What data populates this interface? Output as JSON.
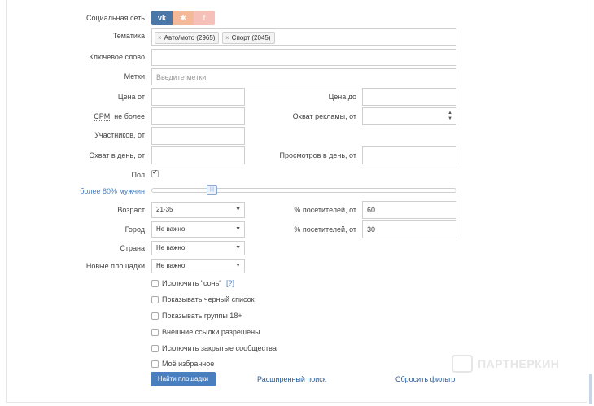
{
  "social": {
    "label": "Социальная сеть",
    "networks": [
      {
        "name": "vk",
        "text": "vk",
        "active": true
      },
      {
        "name": "ok",
        "text": "ok",
        "active": false
      },
      {
        "name": "fb",
        "text": "f",
        "active": false
      }
    ]
  },
  "topic": {
    "label": "Тематика",
    "tags": [
      "Авто/мото (2965)",
      "Спорт (2045)"
    ]
  },
  "keyword": {
    "label": "Ключевое слово",
    "value": ""
  },
  "tags_field": {
    "label": "Метки",
    "placeholder": "Введите метки"
  },
  "price_from": {
    "label": "Цена от",
    "value": ""
  },
  "price_to": {
    "label": "Цена до",
    "value": ""
  },
  "cpm": {
    "label_abbr": "CPM",
    "label_rest": ", не более",
    "value": ""
  },
  "reach": {
    "label": "Охват рекламы, от",
    "value": ""
  },
  "members": {
    "label": "Участников, от",
    "value": ""
  },
  "daily_reach": {
    "label": "Охват в день, от",
    "value": ""
  },
  "daily_views": {
    "label": "Просмотров в день, от",
    "value": ""
  },
  "gender": {
    "label": "Пол",
    "checked": true,
    "slider_caption": "более 80% мужчин",
    "slider_value_percent": 80
  },
  "age": {
    "label": "Возраст",
    "selected": "21-35",
    "pct_label": "% посетителей, от",
    "pct_value": "60"
  },
  "city": {
    "label": "Город",
    "selected": "Не важно",
    "pct_label": "% посетителей, от",
    "pct_value": "30"
  },
  "country": {
    "label": "Страна",
    "selected": "Не важно"
  },
  "new_sites": {
    "label": "Новые площадки",
    "selected": "Не важно"
  },
  "checkboxes": [
    {
      "label": "Исключить \"сонь\"",
      "help": "[?]",
      "checked": false
    },
    {
      "label": "Показывать черный список",
      "checked": false
    },
    {
      "label": "Показывать группы 18+",
      "checked": false
    },
    {
      "label": "Внешние ссылки разрешены",
      "checked": false
    },
    {
      "label": "Исключить закрытые сообщества",
      "checked": false
    },
    {
      "label": "Моё избранное",
      "checked": false
    }
  ],
  "actions": {
    "find": "Найти площадки",
    "advanced": "Расширенный поиск",
    "reset": "Сбросить фильтр"
  },
  "watermark": {
    "text": "ПАРТНЕРКИН"
  },
  "colors": {
    "primary": "#4a7fbf",
    "link": "#2a5d9c",
    "vk_active": "#4a76a8",
    "ok_inactive": "#f3b999",
    "fb_inactive": "#f4c0b8"
  }
}
